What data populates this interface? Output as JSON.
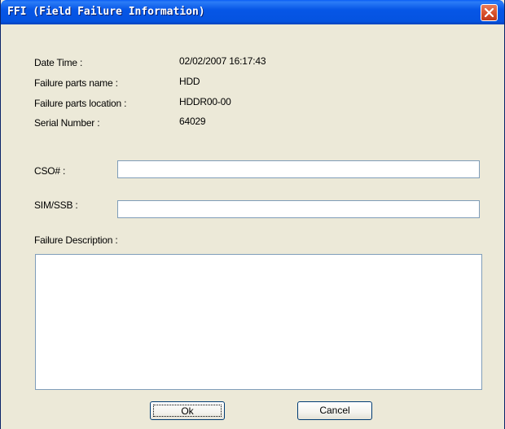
{
  "window": {
    "title": "FFI (Field Failure Information)"
  },
  "info": {
    "date_time_label": "Date Time :",
    "date_time_value": "02/02/2007 16:17:43",
    "parts_name_label": "Failure parts name :",
    "parts_name_value": "HDD",
    "parts_location_label": "Failure parts location :",
    "parts_location_value": "HDDR00-00",
    "serial_label": "Serial Number :",
    "serial_value": "64029"
  },
  "form": {
    "cso_label": "CSO# :",
    "cso_value": "",
    "sim_label": "SIM/SSB :",
    "sim_value": "",
    "desc_label": "Failure Description :",
    "desc_value": ""
  },
  "buttons": {
    "ok_label": "Ok",
    "cancel_label": "Cancel"
  },
  "colors": {
    "title_bar": "#0553e0",
    "dialog_bg": "#ece9d8",
    "close_button": "#d8512b",
    "field_border": "#7f9db9"
  },
  "icons": {
    "close": "close-icon"
  }
}
